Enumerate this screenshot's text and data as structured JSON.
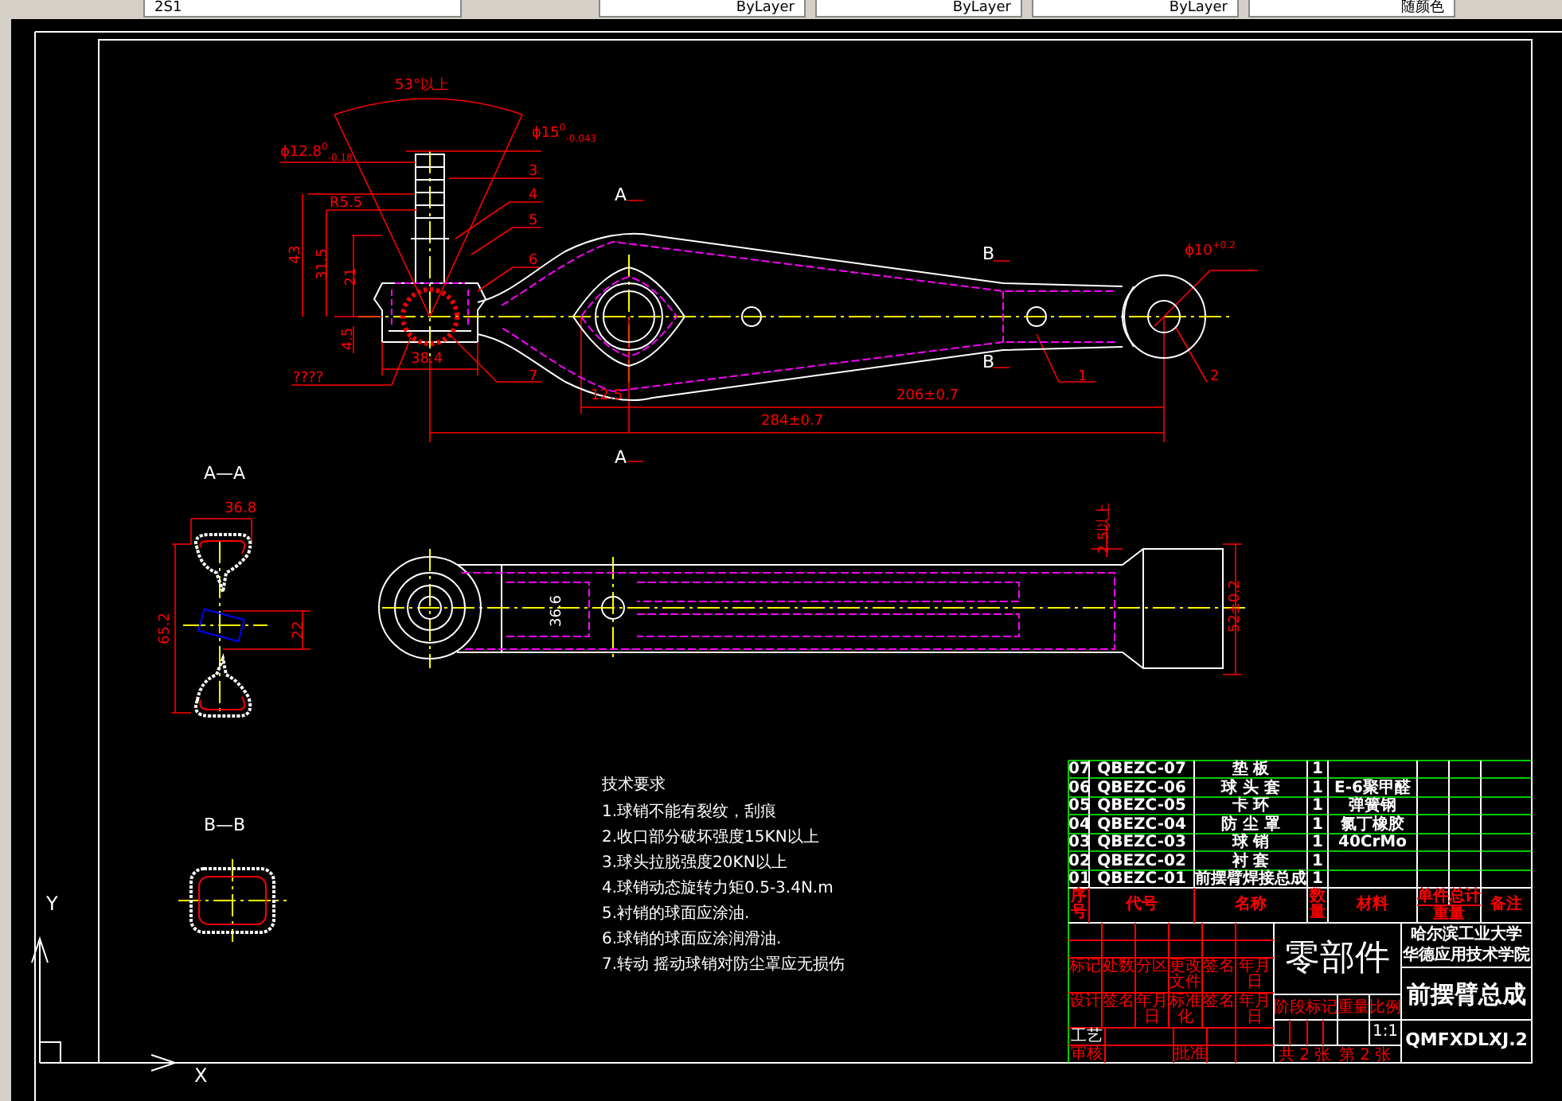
{
  "toolbar": {
    "layer": "2S1",
    "combos": [
      {
        "label": "ByLayer"
      },
      {
        "label": "ByLayer"
      },
      {
        "label": "ByLayer"
      },
      {
        "label": "随颜色"
      }
    ]
  },
  "drawing": {
    "annotations": [
      {
        "kind": "dimension",
        "text": "53°以上"
      },
      {
        "kind": "dimension",
        "text": "ϕ12.8$^{0}$$_{-0.18}$"
      },
      {
        "kind": "dimension",
        "text": "ϕ15$^{0}$$_{-0.043}$"
      },
      {
        "kind": "dimension",
        "text": "R5.5"
      },
      {
        "kind": "vertical_dimension",
        "text": "43"
      },
      {
        "kind": "vertical_dimension",
        "text": "31.5"
      },
      {
        "kind": "vertical_dimension",
        "text": "21"
      },
      {
        "kind": "vertical_dimension",
        "text": "4.5"
      },
      {
        "kind": "dimension",
        "text": "????"
      },
      {
        "kind": "dimension",
        "text": "38.4"
      },
      {
        "kind": "balloon",
        "text": "3"
      },
      {
        "kind": "balloon",
        "text": "4"
      },
      {
        "kind": "balloon",
        "text": "5"
      },
      {
        "kind": "balloon",
        "text": "6"
      },
      {
        "kind": "balloon",
        "text": "7"
      },
      {
        "kind": "balloon",
        "text": "1"
      },
      {
        "kind": "balloon",
        "text": "2"
      },
      {
        "kind": "section_mark",
        "text": "A"
      },
      {
        "kind": "section_mark",
        "text": "A"
      },
      {
        "kind": "section_mark",
        "text": "B"
      },
      {
        "kind": "section_mark",
        "text": "B"
      },
      {
        "kind": "dimension",
        "text": "ϕ10$^{+0.2}$"
      },
      {
        "kind": "dimension",
        "text": "12.5"
      },
      {
        "kind": "dimension",
        "text": "206±0.7"
      },
      {
        "kind": "dimension",
        "text": "284±0.7"
      },
      {
        "kind": "dimension",
        "text": "36.8"
      },
      {
        "kind": "vertical_dimension",
        "text": "65.2"
      },
      {
        "kind": "vertical_dimension",
        "text": "22"
      },
      {
        "kind": "vertical_note",
        "text": "36.6"
      },
      {
        "kind": "vertical_dimension",
        "text": "2.5以上"
      },
      {
        "kind": "vertical_dimension",
        "text": "52±0.2"
      }
    ],
    "view_titles": [
      "A—A",
      "B—B"
    ]
  },
  "technical_requirements": {
    "title": "技术要求",
    "items": [
      "1.球销不能有裂纹，刮痕",
      "2.收口部分破坏强度15KN以上",
      "3.球头拉脱强度20KN以上",
      "4.球销动态旋转力矩0.5-3.4N.m",
      "5.衬销的球面应涂油.",
      "6.球销的球面应涂润滑油.",
      "7.转动 摇动球销对防尘罩应无损伤"
    ]
  },
  "parts_list": {
    "rows": [
      {
        "no": "07",
        "code": "QBEZC-07",
        "name": "垫 板",
        "qty": "1",
        "material": ""
      },
      {
        "no": "06",
        "code": "QBEZC-06",
        "name": "球 头 套",
        "qty": "1",
        "material": "E-6聚甲醛"
      },
      {
        "no": "05",
        "code": "QBEZC-05",
        "name": "卡 环",
        "qty": "1",
        "material": "弹簧钢"
      },
      {
        "no": "04",
        "code": "QBEZC-04",
        "name": "防 尘 罩",
        "qty": "1",
        "material": "氯丁橡胶"
      },
      {
        "no": "03",
        "code": "QBEZC-03",
        "name": "球 销",
        "qty": "1",
        "material": "40CrMo"
      },
      {
        "no": "02",
        "code": "QBEZC-02",
        "name": "衬 套",
        "qty": "1",
        "material": ""
      },
      {
        "no": "01",
        "code": "QBEZC-01",
        "name": "前摆臂焊接总成",
        "qty": "1",
        "material": ""
      }
    ],
    "header": [
      "序号",
      "代号",
      "名称",
      "数量",
      "材料",
      "单件",
      "总计",
      "备注",
      "重量"
    ]
  },
  "title_block": {
    "part_type": "零部件",
    "school": [
      "哈尔滨工业大学",
      "华德应用技术学院"
    ],
    "drawing_name": "前摆臂总成",
    "drawing_number": "QMFXDLXJ.2",
    "scale": "1:1",
    "sheets": "共 2 张",
    "sheet": "第 2 张",
    "labels": [
      "标记",
      "处数",
      "分区",
      "更改文件",
      "签名",
      "年月日",
      "设计",
      "签名",
      "年月日",
      "标准化",
      "签名",
      "年月日",
      "工艺",
      "审核",
      "批准",
      "阶段标记",
      "重量",
      "比例"
    ]
  },
  "ucs": {
    "y": "Y",
    "x": "X"
  }
}
